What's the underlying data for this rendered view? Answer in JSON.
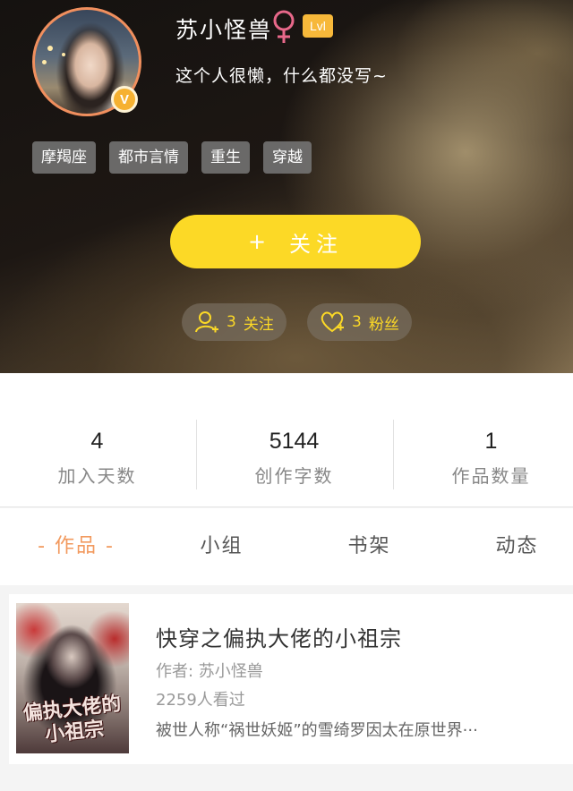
{
  "profile": {
    "username": "苏小怪兽",
    "gender_icon": "female-icon",
    "level": "Lvl",
    "bio": "这个人很懒，什么都没写~",
    "avatar_badge": "V",
    "colors": {
      "accent_orange": "#f08f5e",
      "gender_pink": "#e8688a",
      "level_bg": "#f7b83a",
      "follow_yellow": "#fcd926"
    }
  },
  "tags": [
    "摩羯座",
    "都市言情",
    "重生",
    "穿越"
  ],
  "follow_button": {
    "plus": "+",
    "label": "关注"
  },
  "social": {
    "following": {
      "icon": "add-user-icon",
      "count": "3",
      "label": "关注"
    },
    "fans": {
      "icon": "heart-icon",
      "count": "3",
      "label": "粉丝"
    }
  },
  "stats": [
    {
      "value": "4",
      "label": "加入天数"
    },
    {
      "value": "5144",
      "label": "创作字数"
    },
    {
      "value": "1",
      "label": "作品数量"
    }
  ],
  "tabs": [
    {
      "label": "- 作品 -",
      "active": true
    },
    {
      "label": "小组",
      "active": false
    },
    {
      "label": "书架",
      "active": false
    },
    {
      "label": "动态",
      "active": false
    }
  ],
  "book": {
    "cover_text": "偏执大佬的小祖宗",
    "title": "快穿之偏执大佬的小祖宗",
    "author": "作者: 苏小怪兽",
    "reads": "2259人看过",
    "description": "被世人称“祸世妖姬”的雪绮罗因太在原世界···"
  }
}
